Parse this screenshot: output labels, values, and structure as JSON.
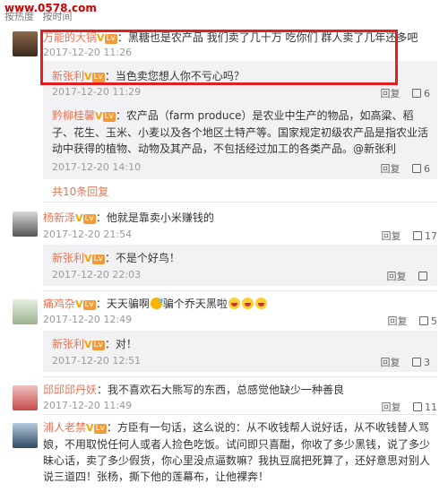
{
  "header": {
    "site": "www.0578.com",
    "sort_hot": "按热度",
    "sort_time": "按时间"
  },
  "comments": [
    {
      "user": "万能的大锅",
      "text": "：黑糖也是农产品 我们卖了几十万 吃你们 群人卖了几年还多吧",
      "time": "2017-12-20 11:26",
      "replies": [
        {
          "user": "新张利",
          "text": "：当色卖您想人你不亏心吗？",
          "time": "2017-12-20 11:29",
          "reply_label": "回复",
          "likes": "6"
        },
        {
          "user": "黔柳桂馨",
          "text": "：农产品（farm produce）是农业中生产的物品，如高粱、稻子、花生、玉米、小麦以及各个地区土特产等。国家规定初级农产品是指农业活动中获得的植物、动物及其产品，不包括经过加工的各类产品。@新张利",
          "time": "2017-12-20 14:10",
          "reply_label": "回复",
          "likes": "6"
        }
      ],
      "more": "共10条回复"
    },
    {
      "user": "杨新泽",
      "text": "：他就是靠卖小米赚钱的",
      "time": "2017-12-20 21:54",
      "reply_label": "回复",
      "likes": "17",
      "replies": [
        {
          "user": "新张利",
          "text": "：不是个好鸟！",
          "time": "2017-12-20 22:03",
          "reply_label": "回复",
          "likes": ""
        }
      ]
    },
    {
      "user": "痛鸡杂",
      "text": "：天天骗啊",
      "text2": "骗个乔天黑啦",
      "time": "2017-12-20 12:49",
      "reply_label": "回复",
      "likes": "5",
      "replies": [
        {
          "user": "新张利",
          "text": "：对！",
          "time": "2017-12-20 12:51",
          "reply_label": "回复",
          "likes": "3"
        }
      ]
    },
    {
      "user": "邱邱邱丹妖",
      "text": "：我不喜欢石大熊写的东西，总感觉他缺少一种善良",
      "time": "2017-12-20 11:49",
      "reply_label": "回复",
      "likes": "11"
    },
    {
      "user": "浦人老禁",
      "text": "：方臣有一句话，这么说的：从不收钱帮人说好话，从不收钱替人骂娘，不用取悦任何人或者人捡色吃饭。试问即只喜酣，你收了多少黑钱，说了多少昧心话，卖了多少假货，你心里没点逼数嘛？我执豆腐把死算了，还好意思对别人说三道四！张杨，撕下他的莲幕布，让他裸奔！"
    }
  ]
}
